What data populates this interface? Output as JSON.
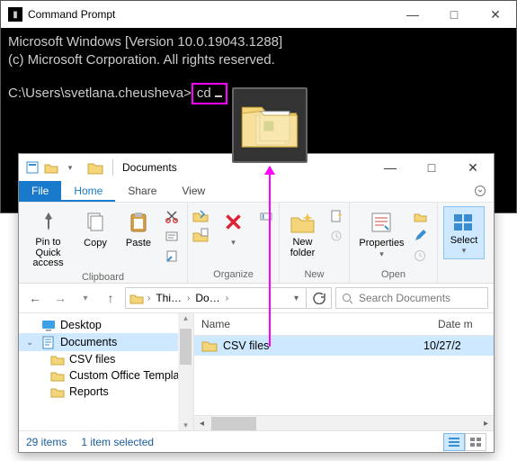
{
  "cmd": {
    "title": "Command Prompt",
    "line1": "Microsoft Windows [Version 10.0.19043.1288]",
    "line2": "(c) Microsoft Corporation. All rights reserved.",
    "prompt": "C:\\Users\\svetlana.cheusheva>",
    "typed": "cd"
  },
  "explorer": {
    "title": "Documents",
    "tabs": {
      "file": "File",
      "home": "Home",
      "share": "Share",
      "view": "View"
    },
    "ribbon": {
      "pin": "Pin to Quick access",
      "copy": "Copy",
      "paste": "Paste",
      "clipboard_label": "Clipboard",
      "organize_label": "Organize",
      "newfolder": "New folder",
      "new_label": "New",
      "properties": "Properties",
      "open_label": "Open",
      "select": "Select"
    },
    "breadcrumb": {
      "seg1": "Thi…",
      "seg2": "Do…"
    },
    "search_placeholder": "Search Documents",
    "tree": {
      "desktop": "Desktop",
      "documents": "Documents",
      "csv": "CSV files",
      "custom": "Custom Office Templa…",
      "reports": "Reports"
    },
    "cols": {
      "name": "Name",
      "date": "Date m"
    },
    "rows": [
      {
        "name": "CSV files",
        "date": "10/27/2"
      }
    ],
    "status": {
      "count": "29 items",
      "selected": "1 item selected"
    }
  }
}
